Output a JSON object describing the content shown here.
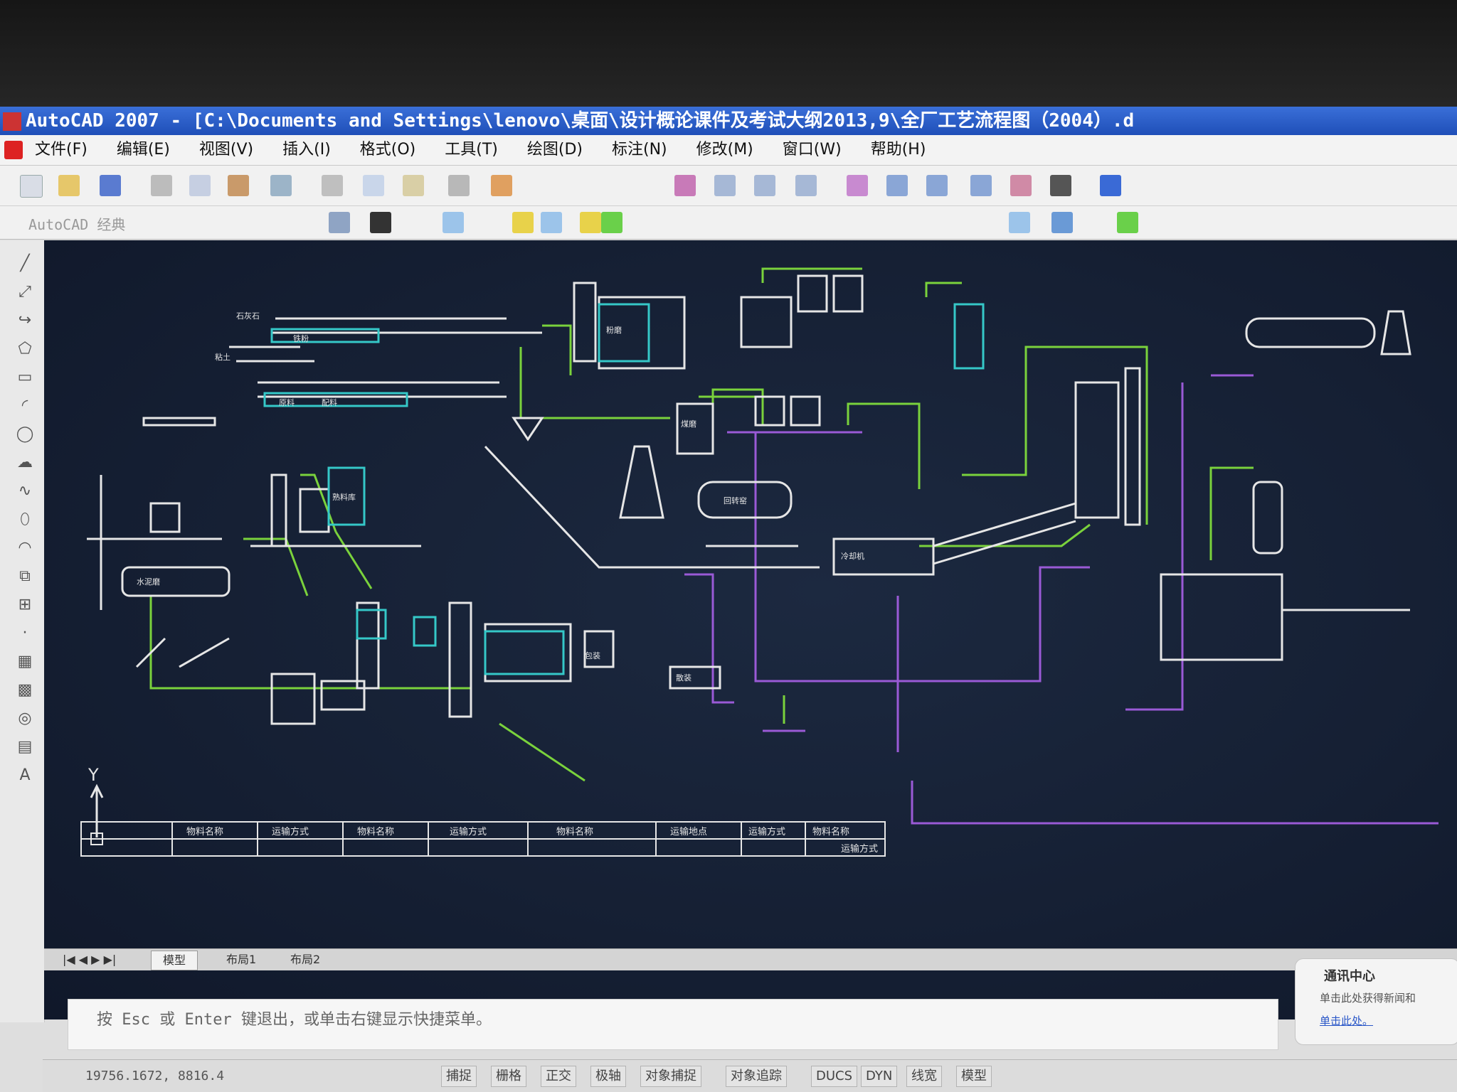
{
  "window": {
    "title": "AutoCAD 2007 - [C:\\Documents and Settings\\lenovo\\桌面\\设计概论课件及考试大纲2013,9\\全厂工艺流程图（2004）.d"
  },
  "menu": [
    "文件(F)",
    "编辑(E)",
    "视图(V)",
    "插入(I)",
    "格式(O)",
    "工具(T)",
    "绘图(D)",
    "标注(N)",
    "修改(M)",
    "窗口(W)",
    "帮助(H)"
  ],
  "workspace_label": "AutoCAD 经典",
  "colors": {
    "canvas": "#162238",
    "line_white": "#e6e6e6",
    "line_green": "#7ad23c",
    "line_purple": "#9a5ad6",
    "line_cyan": "#35c8c8"
  },
  "drawing": {
    "labels": [
      "石灰石",
      "粘土",
      "铁粉",
      "原料",
      "配料",
      "粉磨",
      "煤磨",
      "回转窑",
      "冷却机",
      "熟料库",
      "水泥磨",
      "包装",
      "散装"
    ],
    "table_headers": [
      "物料名称",
      "运输方式",
      "物料名称",
      "运输方式",
      "物料名称",
      "运输地点",
      "运输方式",
      "物料名称",
      "运输方式"
    ]
  },
  "axis": {
    "y": "Y"
  },
  "layout_tabs": [
    "模型",
    "布局1",
    "布局2"
  ],
  "command_line": "按 Esc 或 Enter 键退出，或单击右键显示快捷菜单。",
  "status": {
    "coords": "19756.1672, 8816.4",
    "buttons": [
      "捕捉",
      "栅格",
      "正交",
      "极轴",
      "对象捕捉",
      "对象追踪",
      "DUCS",
      "DYN",
      "线宽",
      "模型"
    ]
  },
  "comm_center": {
    "title": "通讯中心",
    "line": "单击此处获得新闻和",
    "link": "单击此处。"
  }
}
